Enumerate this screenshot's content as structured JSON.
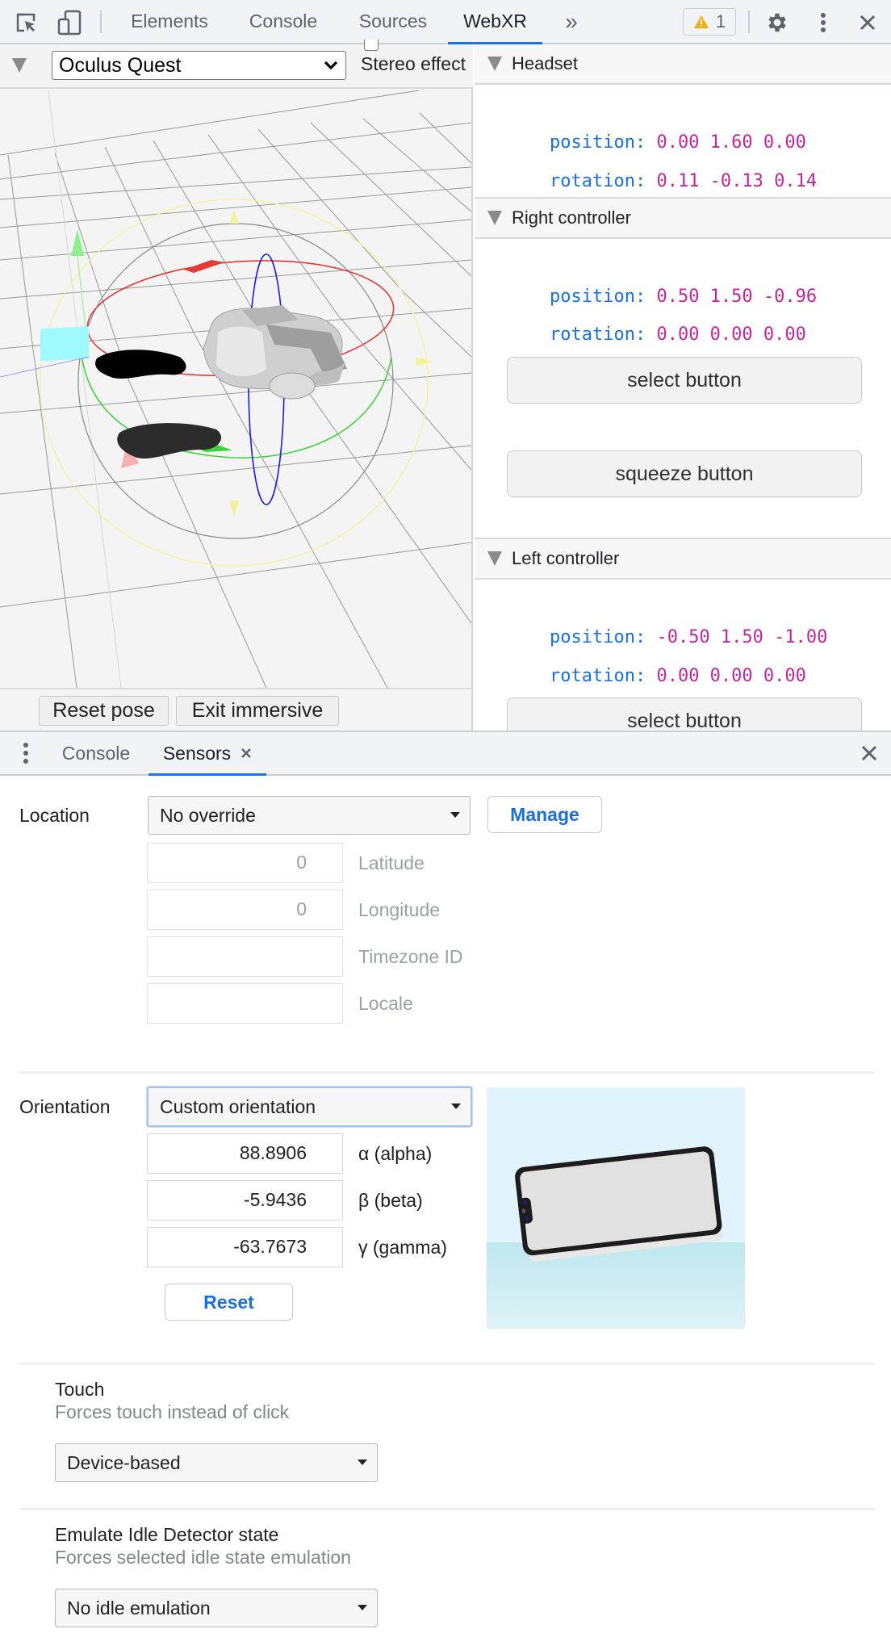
{
  "toolbar": {
    "inspect_icon": "inspect-element-icon",
    "device_icon": "device-toolbar-icon",
    "tabs": [
      {
        "label": "Elements",
        "active": false
      },
      {
        "label": "Console",
        "active": false
      },
      {
        "label": "Sources",
        "active": false
      },
      {
        "label": "WebXR",
        "active": true
      }
    ],
    "more_tabs": "»",
    "warning_count": "1",
    "settings_icon": "gear-icon",
    "menu_icon": "kebab-menu-icon",
    "close_icon": "close-icon"
  },
  "webxr": {
    "device_select": {
      "value": "Oculus Quest"
    },
    "stereo_label": "Stereo effect",
    "stereo_checked": false,
    "actions": {
      "reset_pose": "Reset pose",
      "exit_immersive": "Exit immersive"
    },
    "sections": {
      "headset": {
        "title": "Headset",
        "position_label": "position:",
        "position_value": "0.00 1.60 0.00",
        "rotation_label": "rotation:",
        "rotation_value": "0.11 -0.13 0.14"
      },
      "right_controller": {
        "title": "Right controller",
        "position_label": "position:",
        "position_value": "0.50 1.50 -0.96",
        "rotation_label": "rotation:",
        "rotation_value": "0.00 0.00 0.00",
        "select_button": "select button",
        "squeeze_button": "squeeze button"
      },
      "left_controller": {
        "title": "Left controller",
        "position_label": "position:",
        "position_value": "-0.50 1.50 -1.00",
        "rotation_label": "rotation:",
        "rotation_value": "0.00 0.00 0.00",
        "select_button": "select button"
      }
    },
    "colors": {
      "key": "#1a6fdd",
      "value": "#c2259e"
    }
  },
  "drawer": {
    "menu_icon": "kebab-menu-icon",
    "tabs": [
      {
        "label": "Console",
        "active": false
      },
      {
        "label": "Sensors",
        "active": true,
        "closable": true
      }
    ],
    "close_icon": "close-icon"
  },
  "sensors": {
    "location": {
      "label": "Location",
      "select_value": "No override",
      "manage_button": "Manage",
      "fields": [
        {
          "value": "0",
          "label": "Latitude"
        },
        {
          "value": "0",
          "label": "Longitude"
        },
        {
          "value": "",
          "label": "Timezone ID"
        },
        {
          "value": "",
          "label": "Locale"
        }
      ]
    },
    "orientation": {
      "label": "Orientation",
      "select_value": "Custom orientation",
      "alpha": {
        "value": "88.8906",
        "label": "α (alpha)"
      },
      "beta": {
        "value": "-5.9436",
        "label": "β (beta)"
      },
      "gamma": {
        "value": "-63.7673",
        "label": "γ (gamma)"
      },
      "reset_button": "Reset"
    },
    "touch": {
      "title": "Touch",
      "description": "Forces touch instead of click",
      "select_value": "Device-based"
    },
    "idle": {
      "title": "Emulate Idle Detector state",
      "description": "Forces selected idle state emulation",
      "select_value": "No idle emulation"
    }
  },
  "accent_color": "#1a73e8"
}
